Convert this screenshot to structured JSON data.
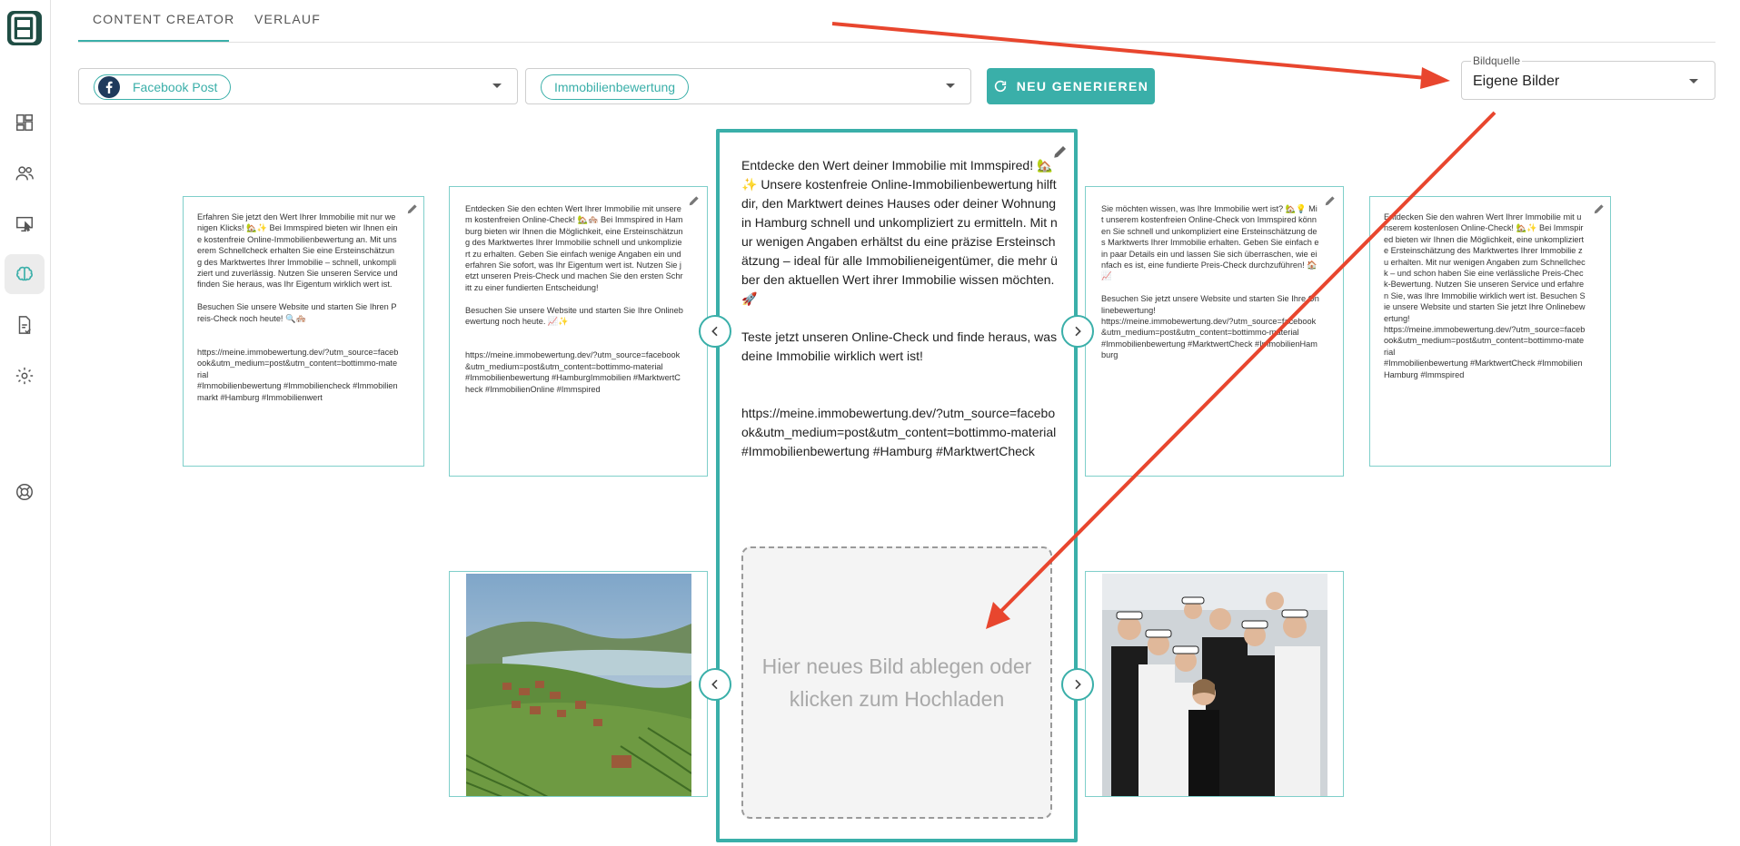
{
  "tabs": [
    {
      "label": "CONTENT CREATOR"
    },
    {
      "label": "VERLAUF"
    }
  ],
  "controls": {
    "post_type": "Facebook Post",
    "topic": "Immobilienbewertung",
    "generate_label": "NEU GENERIEREN",
    "image_source_label": "Bildquelle",
    "image_source_value": "Eigene Bilder"
  },
  "cards": {
    "far_left": "Erfahren Sie jetzt den Wert Ihrer Immobilie mit nur wenigen Klicks! 🏡✨ Bei Immspired bieten wir Ihnen eine kostenfreie Online-Immobilienbewertung an. Mit unserem Schnellcheck erhalten Sie eine Ersteinschätzung des Marktwertes Ihrer Immobilie – schnell, unkompliziert und zuverlässig. Nutzen Sie unseren Service und finden Sie heraus, was Ihr Eigentum wirklich wert ist.\n\nBesuchen Sie unsere Website und starten Sie Ihren Preis-Check noch heute! 🔍🏘️\n\n\nhttps://meine.immobewertung.dev/?utm_source=facebook&utm_medium=post&utm_content=bottimmo-material\n#Immobilienbewertung #Immobiliencheck #Immobilienmarkt #Hamburg #Immobilienwert",
    "left": "Entdecken Sie den echten Wert Ihrer Immobilie mit unserem kostenfreien Online-Check! 🏡🏘️ Bei Immspired in Hamburg bieten wir Ihnen die Möglichkeit, eine Ersteinschätzung des Marktwertes Ihrer Immobilie schnell und unkompliziert zu erhalten. Geben Sie einfach wenige Angaben ein und erfahren Sie sofort, was Ihr Eigentum wert ist. Nutzen Sie jetzt unseren Preis-Check und machen Sie den ersten Schritt zu einer fundierten Entscheidung!\n\nBesuchen Sie unsere Website und starten Sie Ihre Onlinebewertung noch heute. 📈✨\n\n\nhttps://meine.immobewertung.dev/?utm_source=facebook&utm_medium=post&utm_content=bottimmo-material\n#Immobilienbewertung #HamburgImmobilien #MarktwertCheck #ImmobilienOnline #Immspired",
    "main": "Entdecke den Wert deiner Immobilie mit Immspired! 🏡✨ Unsere kostenfreie Online-Immobilienbewertung hilft dir, den Marktwert deines Hauses oder deiner Wohnung in Hamburg schnell und unkompliziert zu ermitteln. Mit nur wenigen Angaben erhältst du eine präzise Ersteinschätzung – ideal für alle Immobilieneigentümer, die mehr über den aktuellen Wert ihrer Immobilie wissen möchten. 🚀\n\nTeste jetzt unseren Online-Check und finde heraus, was deine Immobilie wirklich wert ist!\n\n\nhttps://meine.immobewertung.dev/?utm_source=facebook&utm_medium=post&utm_content=bottimmo-material\n#Immobilienbewertung #Hamburg #MarktwertCheck",
    "right": "Sie möchten wissen, was Ihre Immobilie wert ist? 🏡💡 Mit unserem kostenfreien Online-Check von Immspired können Sie schnell und unkompliziert eine Ersteinschätzung des Marktwerts Ihrer Immobilie erhalten. Geben Sie einfach ein paar Details ein und lassen Sie sich überraschen, wie einfach es ist, eine fundierte Preis-Check durchzuführen! 🏠📈\n\nBesuchen Sie jetzt unsere Website und starten Sie Ihre Onlinebewertung!\nhttps://meine.immobewertung.dev/?utm_source=facebook&utm_medium=post&utm_content=bottimmo-material\n#Immobilienbewertung #MarktwertCheck #ImmobilienHamburg",
    "far_right": "Entdecken Sie den wahren Wert Ihrer Immobilie mit unserem kostenlosen Online-Check! 🏡✨ Bei Immspired bieten wir Ihnen die Möglichkeit, eine unkomplizierte Ersteinschätzung des Marktwertes Ihrer Immobilie zu erhalten. Mit nur wenigen Angaben zum Schnellcheck – und schon haben Sie eine verlässliche Preis-Check-Bewertung. Nutzen Sie unseren Service und erfahren Sie, was Ihre Immobilie wirklich wert ist. Besuchen Sie unsere Website und starten Sie jetzt Ihre Onlinebewertung!\nhttps://meine.immobewertung.dev/?utm_source=facebook&utm_medium=post&utm_content=bottimmo-material\n#Immobilienbewertung #MarktwertCheck #ImmobilienHamburg #Immspired"
  },
  "dropzone_text": "Hier neues Bild ablegen oder klicken zum Hochladen",
  "colors": {
    "accent": "#3aafa9",
    "annotation": "#e8462e"
  }
}
